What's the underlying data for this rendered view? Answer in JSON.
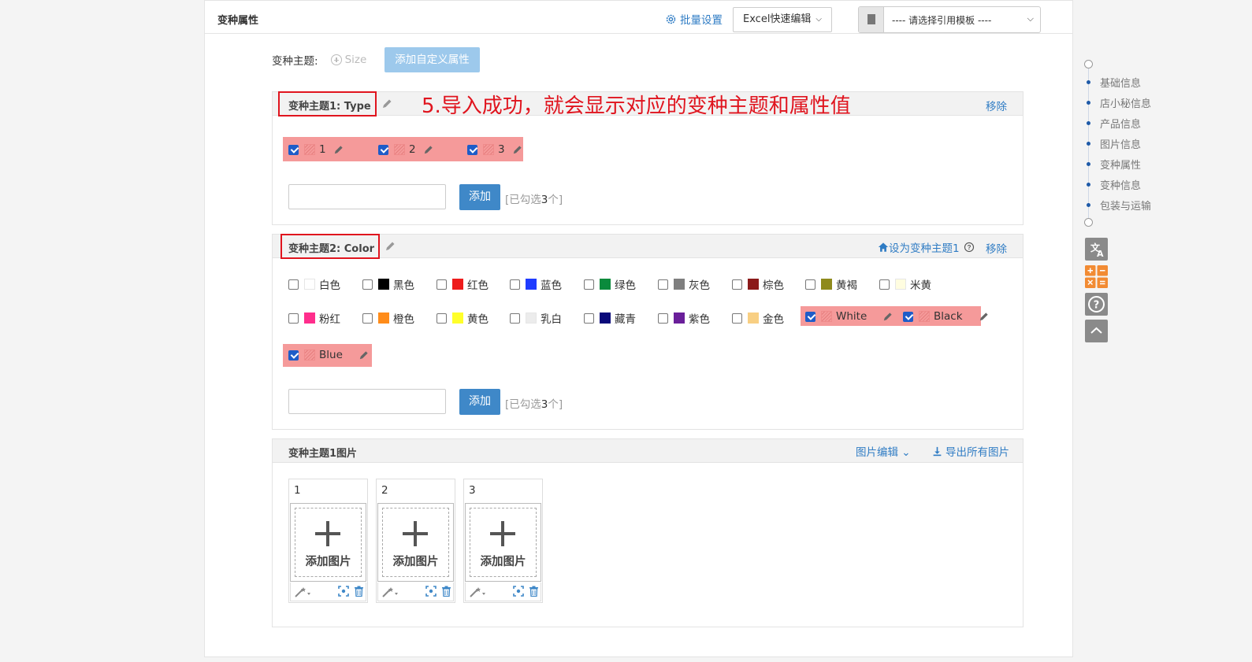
{
  "panel": {
    "title": "变种属性",
    "batch_settings": "批量设置",
    "excel_edit": "Excel快速编辑",
    "template_select": "---- 请选择引用模板 ----"
  },
  "theme_row": {
    "label": "变种主题:",
    "size_option": "Size",
    "add_custom": "添加自定义属性"
  },
  "annotation": "5.导入成功，就会显示对应的变种主题和属性值",
  "section1": {
    "title": "变种主题1:   Type",
    "remove": "移除",
    "options": [
      {
        "label": "1",
        "checked": true
      },
      {
        "label": "2",
        "checked": true
      },
      {
        "label": "3",
        "checked": true
      }
    ],
    "add_button": "添加",
    "selected_prefix": "[已勾选",
    "selected_count": "3",
    "selected_suffix": "个]"
  },
  "section2": {
    "title": "变种主题2:   Color",
    "set_as_theme1": "设为变种主题1",
    "remove": "移除",
    "colors": [
      {
        "label": "白色",
        "color": "#ffffff"
      },
      {
        "label": "黑色",
        "color": "#000000"
      },
      {
        "label": "红色",
        "color": "#ee1c1c"
      },
      {
        "label": "蓝色",
        "color": "#1f3cff"
      },
      {
        "label": "绿色",
        "color": "#0a8a3c"
      },
      {
        "label": "灰色",
        "color": "#7f7f7f"
      },
      {
        "label": "棕色",
        "color": "#8b1a1a"
      },
      {
        "label": "黄褐",
        "color": "#8f8a1c"
      },
      {
        "label": "米黄",
        "color": "#fffde0"
      },
      {
        "label": "粉红",
        "color": "#ff2e8c"
      },
      {
        "label": "橙色",
        "color": "#ff8c1a"
      },
      {
        "label": "黄色",
        "color": "#ffff2a"
      },
      {
        "label": "乳白",
        "color": "#ececec"
      },
      {
        "label": "藏青",
        "color": "#0a0a7a"
      },
      {
        "label": "紫色",
        "color": "#6a1f9a"
      },
      {
        "label": "金色",
        "color": "#f8cf83"
      }
    ],
    "custom": [
      {
        "label": "White",
        "checked": true
      },
      {
        "label": "Black",
        "checked": true
      },
      {
        "label": "Blue",
        "checked": true
      }
    ],
    "add_button": "添加",
    "selected_prefix": "[已勾选",
    "selected_count": "3",
    "selected_suffix": "个]"
  },
  "images": {
    "title": "变种主题1图片",
    "edit": "图片编辑",
    "export": "导出所有图片",
    "cards": [
      {
        "num": "1",
        "add": "添加图片"
      },
      {
        "num": "2",
        "add": "添加图片"
      },
      {
        "num": "3",
        "add": "添加图片"
      }
    ]
  },
  "side_nav": [
    "基础信息",
    "店小秘信息",
    "产品信息",
    "图片信息",
    "变种属性",
    "变种信息",
    "包装与运输"
  ],
  "side_buttons": [
    "translate-icon",
    "calculator-icon",
    "help-icon",
    "back-to-top-icon"
  ]
}
